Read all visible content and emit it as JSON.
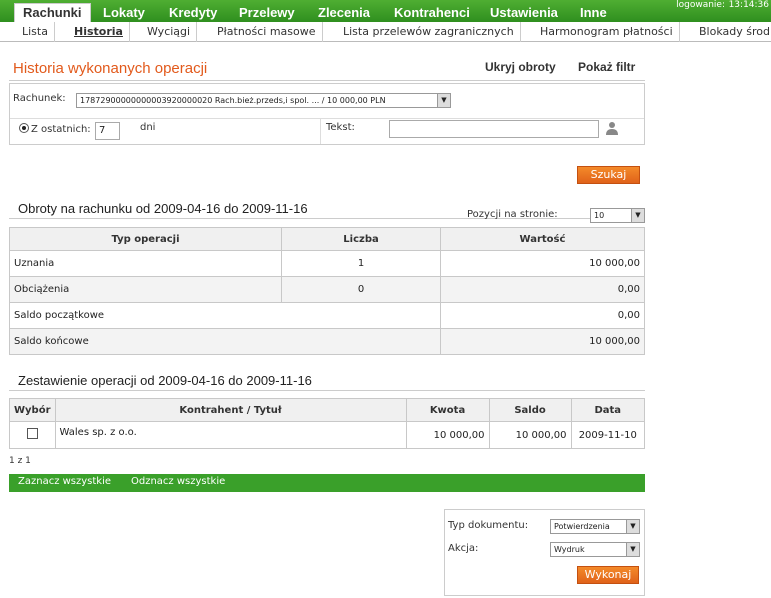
{
  "topbar": {
    "tabs": [
      "Rachunki",
      "Lokaty",
      "Kredyty",
      "Przelewy",
      "Zlecenia",
      "Kontrahenci",
      "Ustawienia",
      "Inne"
    ],
    "status_label": "logowanie:",
    "clock": "13:14:36"
  },
  "subnav": {
    "tabs": [
      "Lista",
      "Historia",
      "Wyciągi",
      "Płatności masowe",
      "Lista przelewów zagranicznych",
      "Harmonogram płatności",
      "Blokady środk"
    ]
  },
  "header": {
    "title": "Historia wykonanych operacji",
    "hide_turnover": "Ukryj obroty",
    "show_filter": "Pokaż filtr"
  },
  "filter": {
    "account_label": "Rachunek:",
    "account_value": "17872900000000003920000020 Rach.bież.przeds,i spol. ... / 10 000,00 PLN",
    "last_label": "Z ostatnich:",
    "last_value": "7",
    "days_label": "dni",
    "text_label": "Tekst:",
    "text_value": "",
    "search_button": "Szukaj"
  },
  "turnover": {
    "title": "Obroty na rachunku od 2009-04-16 do 2009-11-16",
    "per_page_label": "Pozycji na stronie:",
    "per_page_value": "10",
    "headers": [
      "Typ operacji",
      "Liczba",
      "Wartość"
    ],
    "rows": [
      {
        "type": "Uznania",
        "count": "1",
        "value": "10 000,00"
      },
      {
        "type": "Obciążenia",
        "count": "0",
        "value": "0,00"
      }
    ],
    "opening_label": "Saldo początkowe",
    "opening_value": "0,00",
    "closing_label": "Saldo końcowe",
    "closing_value": "10 000,00"
  },
  "operations": {
    "title": "Zestawienie operacji od 2009-04-16 do 2009-11-16",
    "headers": [
      "Wybór",
      "Kontrahent / Tytuł",
      "Kwota",
      "Saldo",
      "Data"
    ],
    "rows": [
      {
        "party": "Wales sp. z o.o.",
        "amount": "10 000,00",
        "balance": "10 000,00",
        "date": "2009-11-10"
      }
    ],
    "pager": "1 z 1",
    "select_all": "Zaznacz wszystkie",
    "deselect_all": "Odznacz wszystkie"
  },
  "document": {
    "type_label": "Typ dokumentu:",
    "type_value": "Potwierdzenia",
    "action_label": "Akcja:",
    "action_value": "Wydruk",
    "execute_button": "Wykonaj"
  },
  "colors": {
    "accent_orange": "#e25a1c",
    "brand_green": "#3aa02a"
  }
}
